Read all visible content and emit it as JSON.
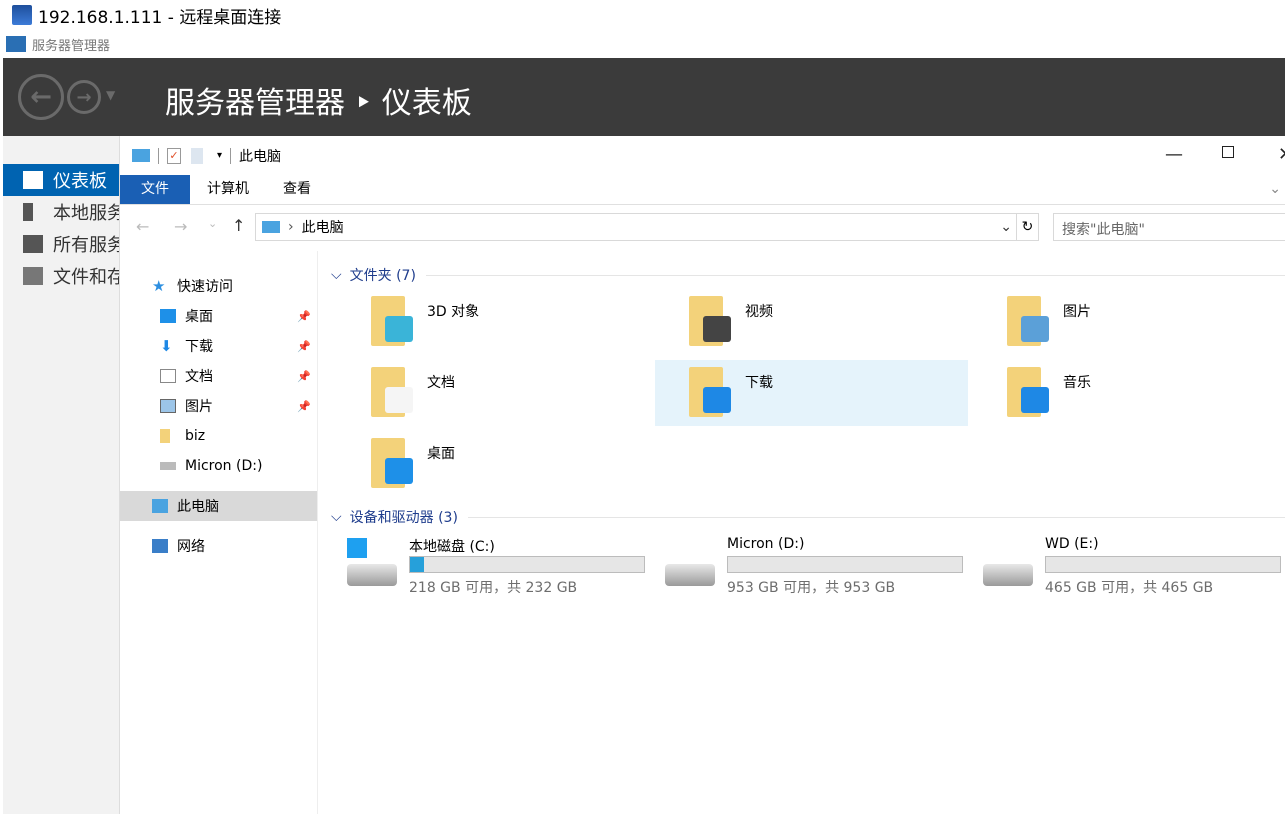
{
  "rdp_title": "192.168.1.111 - 远程桌面连接",
  "server_manager": {
    "app_name": "服务器管理器",
    "breadcrumb": "服务器管理器 ‣ 仪表板",
    "nav": [
      {
        "label": "仪表板",
        "active": true
      },
      {
        "label": "本地服务器"
      },
      {
        "label": "所有服务器"
      },
      {
        "label": "文件和存储服务"
      }
    ]
  },
  "explorer": {
    "title": "此电脑",
    "tabs": [
      "文件",
      "计算机",
      "查看"
    ],
    "address": "此电脑",
    "search_placeholder": "搜索\"此电脑\"",
    "nav": [
      {
        "label": "快速访问"
      },
      {
        "label": "桌面",
        "pinned": true
      },
      {
        "label": "下载",
        "pinned": true
      },
      {
        "label": "文档",
        "pinned": true
      },
      {
        "label": "图片",
        "pinned": true
      },
      {
        "label": "biz"
      },
      {
        "label": "Micron (D:)"
      },
      {
        "label": "此电脑",
        "selected": true
      },
      {
        "label": "网络"
      }
    ],
    "folders_header": "文件夹 (7)",
    "folders": [
      {
        "name": "3D 对象",
        "overlay": "#3ab4d8"
      },
      {
        "name": "视频",
        "overlay": "#444"
      },
      {
        "name": "图片",
        "overlay": "#5ba0d8"
      },
      {
        "name": "文档",
        "overlay": "#f5f5f5"
      },
      {
        "name": "下载",
        "overlay": "#1e88e5",
        "selected": true
      },
      {
        "name": "音乐",
        "overlay": "#1e88e5"
      },
      {
        "name": "桌面",
        "overlay": "#1e90e8"
      }
    ],
    "drives_header": "设备和驱动器 (3)",
    "drives": [
      {
        "name": "本地磁盘 (C:)",
        "free": "218 GB 可用，共 232 GB",
        "used_fraction": 0.06
      },
      {
        "name": "Micron (D:)",
        "free": "953 GB 可用，共 953 GB",
        "used_fraction": 0
      },
      {
        "name": "WD (E:)",
        "free": "465 GB 可用，共 465 GB",
        "used_fraction": 0
      }
    ]
  }
}
